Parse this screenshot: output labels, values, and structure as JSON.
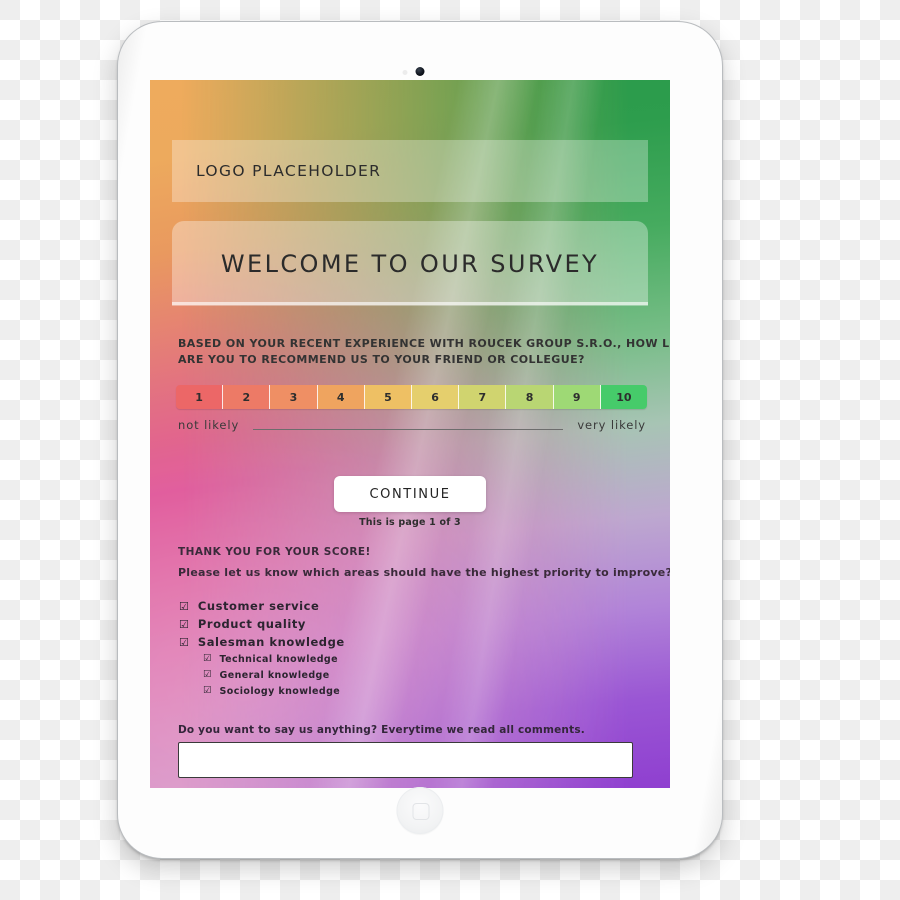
{
  "device": {
    "name": "tablet-mockup",
    "camera_icon": "camera-dot",
    "sensor_icon": "ambient-light-sensor",
    "home_button_icon": "home-button-square"
  },
  "screen": {
    "header": {
      "logo_text": "LOGO PLACEHOLDER"
    },
    "welcome": {
      "title": "WELCOME TO OUR  SURVEY"
    },
    "question": {
      "line1": "BASED ON YOUR RECENT EXPERIENCE WITH ROUCEK GROUP S.R.O., HOW LIKELY",
      "line2": "ARE YOU TO RECOMMEND US TO YOUR FRIEND OR COLLEGUE?"
    },
    "scale": {
      "values": [
        "1",
        "2",
        "3",
        "4",
        "5",
        "6",
        "7",
        "8",
        "9",
        "10"
      ],
      "colors": [
        "#ec6767",
        "#ed7a66",
        "#ef8f64",
        "#efa45f",
        "#eec064",
        "#e5cf6d",
        "#d0d46f",
        "#b9d673",
        "#9ed975",
        "#46cb6a"
      ],
      "low_label": "not likely",
      "high_label": "very likely"
    },
    "actions": {
      "continue_label": "CONTINUE",
      "page_indicator": "This is page 1 of 3"
    },
    "thanks": {
      "title": "THANK YOU FOR YOUR SCORE!",
      "subtitle": "Please let us know which areas should have the highest priority to improve?"
    },
    "checklist": {
      "checkbox_glyph": "☑",
      "items": [
        {
          "label": "Customer service",
          "level": 0
        },
        {
          "label": "Product quality",
          "level": 0
        },
        {
          "label": "Salesman knowledge",
          "level": 0
        },
        {
          "label": "Technical knowledge",
          "level": 1
        },
        {
          "label": "General knowledge",
          "level": 1
        },
        {
          "label": "Sociology knowledge",
          "level": 1
        }
      ]
    },
    "comment": {
      "prompt": "Do you want to say us anything? Everytime we read all comments.",
      "value": "",
      "placeholder": ""
    },
    "theme": {
      "gradient_top_left": "#eeab5d",
      "gradient_top_right": "#2a9a4a",
      "gradient_bottom_left": "#e0589a",
      "gradient_bottom_right": "#8f3fd0",
      "panel_overlay": "rgba(255,255,255,0.32)",
      "button_background": "#ffffff"
    }
  }
}
